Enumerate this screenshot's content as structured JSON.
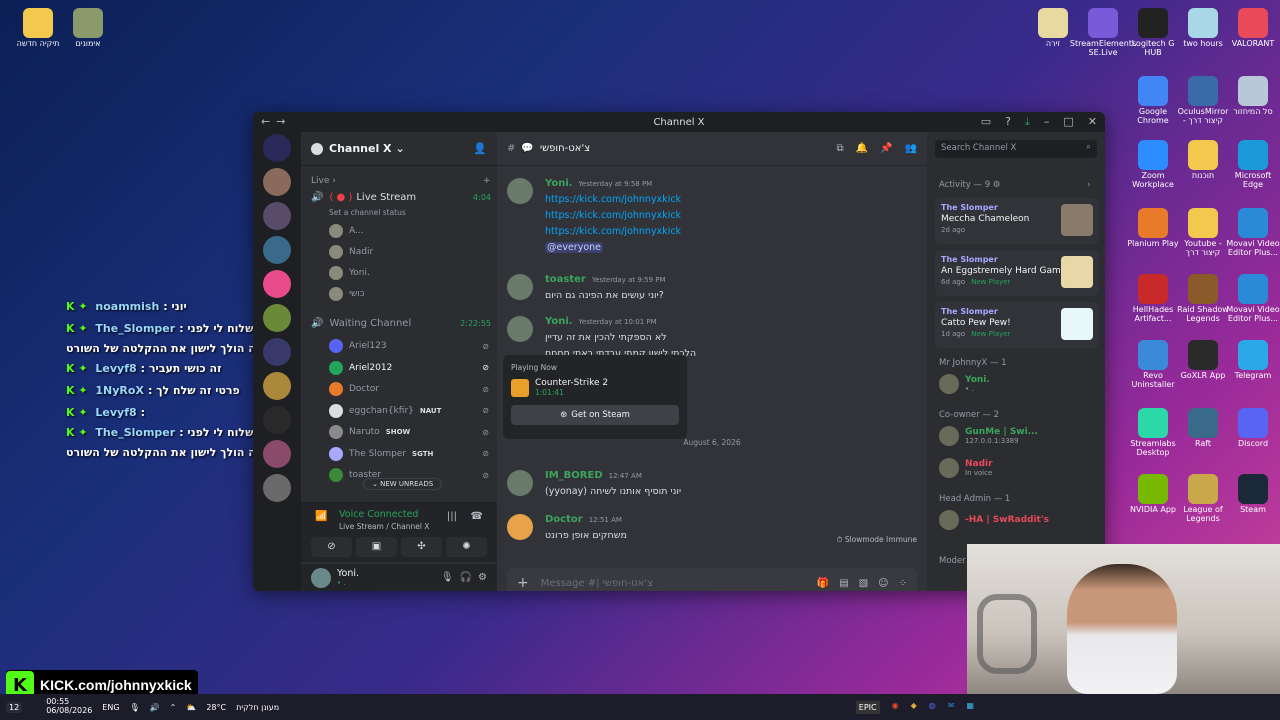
{
  "desktop": {
    "left_icons": [
      {
        "label": "תיקיה חדשה",
        "icon": "folder-icon",
        "color": "#f2c94c"
      },
      {
        "label": "אימונים",
        "icon": "notebook-icon",
        "color": "#8a9a6a"
      }
    ],
    "right_icons": [
      {
        "label": "זירה",
        "icon": "folder-icon",
        "color": "#e8d9a0"
      },
      {
        "label": "StreamElements SE.Live",
        "icon": "streamelements-icon",
        "color": "#7a5ad8"
      },
      {
        "label": "Logitech G HUB",
        "icon": "logitech-icon",
        "color": "#222222"
      },
      {
        "label": "two hours",
        "icon": "image-icon",
        "color": "#a8d8e8"
      },
      {
        "label": "VALORANT",
        "icon": "valorant-icon",
        "color": "#e84a5a"
      },
      {
        "label": "Google Chrome",
        "icon": "chrome-icon",
        "color": "#4285f4"
      },
      {
        "label": "OculusMirror - קיצור דרך",
        "icon": "oculus-icon",
        "color": "#3a6aa8"
      },
      {
        "label": "סל המיחזור",
        "icon": "recycle-bin-icon",
        "color": "#b8c8d8"
      },
      {
        "label": "Zoom Workplace",
        "icon": "zoom-icon",
        "color": "#2d8cff"
      },
      {
        "label": "תוכנות",
        "icon": "folder-icon",
        "color": "#f2c94c"
      },
      {
        "label": "Microsoft Edge",
        "icon": "edge-icon",
        "color": "#1a9ad8"
      },
      {
        "label": "Planium Play",
        "icon": "planium-icon",
        "color": "#e87a2a"
      },
      {
        "label": "Youtube - קיצור דרך",
        "icon": "folder-icon",
        "color": "#f2c94c"
      },
      {
        "label": "Movavi Video Editor Plus...",
        "icon": "movavi-icon",
        "color": "#2a8ad8"
      },
      {
        "label": "HellHades Artifact...",
        "icon": "hellhades-icon",
        "color": "#c82a2a"
      },
      {
        "label": "Raid Shadow Legends",
        "icon": "raid-icon",
        "color": "#8a5a2a"
      },
      {
        "label": "Movavi Video Editor Plus...",
        "icon": "movavi-icon",
        "color": "#2a8ad8"
      },
      {
        "label": "Revo Uninstaller",
        "icon": "revo-icon",
        "color": "#3a8ad8"
      },
      {
        "label": "GoXLR App",
        "icon": "goxlr-icon",
        "color": "#2a2a2a"
      },
      {
        "label": "Telegram",
        "icon": "telegram-icon",
        "color": "#2aa8e8"
      },
      {
        "label": "Streamlabs Desktop",
        "icon": "streamlabs-icon",
        "color": "#2ad8a8"
      },
      {
        "label": "Raft",
        "icon": "raft-icon",
        "color": "#3a6a8a"
      },
      {
        "label": "Discord",
        "icon": "discord-icon",
        "color": "#5865f2"
      },
      {
        "label": "NVIDIA App",
        "icon": "nvidia-icon",
        "color": "#76b900"
      },
      {
        "label": "League of Legends",
        "icon": "league-icon",
        "color": "#c8a84a"
      },
      {
        "label": "Steam",
        "icon": "steam-icon",
        "color": "#1b2838"
      }
    ]
  },
  "window": {
    "title": "Channel X"
  },
  "server": {
    "name": "Channel X"
  },
  "channels": {
    "live_category": "Live",
    "live_stream": {
      "name": "Live Stream",
      "status": "Set a channel status",
      "timer": "4:04"
    },
    "live_users": [
      "A...",
      "Nadir",
      "Yoni.",
      "כושי"
    ],
    "waiting": {
      "name": "Waiting Channel",
      "timer": "2:22:55"
    },
    "waiting_users": [
      {
        "name": "Ariel123",
        "badge": "",
        "color": "#5865f2"
      },
      {
        "name": "Ariel2012",
        "badge": "",
        "color": "#23a55a"
      },
      {
        "name": "Doctor",
        "badge": "",
        "color": "#e87a2a"
      },
      {
        "name": "eggchan{kfir}",
        "badge": "NAUT",
        "color": "#dbdee1"
      },
      {
        "name": "Naruto",
        "badge": "SHOW",
        "color": "#8a8a8a"
      },
      {
        "name": "The Slomper",
        "badge": "SGTH",
        "color": "#a8a8ff"
      },
      {
        "name": "toaster",
        "badge": "",
        "color": "#3a8a3a"
      }
    ],
    "new_unreads": "NEW UNREADS"
  },
  "voice": {
    "status": "Voice Connected",
    "location": "Live Stream / Channel X"
  },
  "user": {
    "name": "Yoni.",
    "status": "• ."
  },
  "chat": {
    "channel_name": "צ'אט-חופשי",
    "messages": [
      {
        "author": "Yoni.",
        "time": "Yesterday at 9:58 PM",
        "color": "#3ba55c",
        "lines": [
          "https://kick.com/johnnyxkick",
          "https://kick.com/johnnyxkick",
          "https://kick.com/johnnyxkick"
        ],
        "mention": "@everyone"
      },
      {
        "author": "toaster",
        "time": "Yesterday at 9:59 PM",
        "color": "#3ba55c",
        "lines": [
          "יוני עושים את הפינה גם היום?"
        ]
      },
      {
        "author": "Yoni.",
        "time": "Yesterday at 10:01 PM",
        "color": "#3ba55c",
        "lines": [
          "לא הספקתי להכין את זה עדיין",
          "הלכתי לישון קמתי עבדתי באתי חחחח"
        ]
      },
      {
        "author": "IM_BORED",
        "time": "12:47 AM",
        "color": "#3ba55c",
        "lines": [
          "(yyonay) יוני תוסיף אותנו לשיחה"
        ]
      },
      {
        "author": "Doctor",
        "time": "12:51 AM",
        "color": "#3ba55c",
        "lines": [
          "משחקים אופן פרונט"
        ]
      }
    ],
    "date_divider": "August 6, 2026",
    "popout": {
      "header": "Playing Now",
      "game": "Counter-Strike 2",
      "time": "1:01:41",
      "button": "Get on Steam"
    },
    "slowmode": "Slowmode Immune",
    "composer_placeholder": "Message #| צ'אט-חופשי"
  },
  "members": {
    "search_placeholder": "Search Channel X",
    "activity_title": "Activity — 9",
    "activities": [
      {
        "user": "The Slomper",
        "game": "Meccha Chameleon",
        "when": "2d ago",
        "extra": ""
      },
      {
        "user": "The Slomper",
        "game": "An Eggstremely Hard Game",
        "when": "6d ago",
        "extra": "New Player"
      },
      {
        "user": "The Slomper",
        "game": "Catto Pew Pew!",
        "when": "1d ago",
        "extra": "New Player"
      }
    ],
    "groups": [
      {
        "title": "Mr JohnnyX — 1",
        "members": [
          {
            "name": "Yoni.",
            "sub": "• .",
            "color": "#3ba55c"
          }
        ]
      },
      {
        "title": "Co-owner — 2",
        "members": [
          {
            "name": "GunMe | Swi...",
            "sub": "127.0.0.1:3389",
            "color": "#3ba55c"
          },
          {
            "name": "Nadir",
            "sub": "In voice",
            "color": "#e84a5a"
          }
        ]
      },
      {
        "title": "Head Admin — 1",
        "members": [
          {
            "name": "-HA | SwRaddit's",
            "sub": "",
            "color": "#e84a5a"
          }
        ]
      }
    ],
    "more": "Moder"
  },
  "overlay_chat": [
    {
      "user": "noammish",
      "text": ": יוני",
      "color": "#9ad8ff"
    },
    {
      "user": "The_Slomper",
      "text": ": יוני תוכל אבל לשלוח לי לפני",
      "color": "#9ad8ff"
    },
    {
      "user": "",
      "text": "שאתה הולך לישון את ההקלטה של השורט?",
      "color": "#ffffff"
    },
    {
      "user": "Levyf8",
      "text": ": זה כושי תעביר",
      "color": "#9ad8ff"
    },
    {
      "user": "1NyRoX",
      "text": ": פרטי זה שלח לך",
      "color": "#9ad8ff"
    },
    {
      "user": "Levyf8",
      "text": ":",
      "color": "#9ad8ff"
    },
    {
      "user": "The_Slomper",
      "text": ": יוני תוכל אבל לשלוח לי לפני",
      "color": "#9ad8ff"
    },
    {
      "user": "",
      "text": "שאתה הולך לישון את ההקלטה של השורט?",
      "color": "#ffffff"
    }
  ],
  "kick_banner": "KICK.com/johnnyxkick",
  "taskbar": {
    "time": "00:55",
    "date": "06/08/2026",
    "lang": "ENG",
    "weather": "28°C",
    "weather_text": "מעונן חלקית",
    "badge": "12"
  }
}
